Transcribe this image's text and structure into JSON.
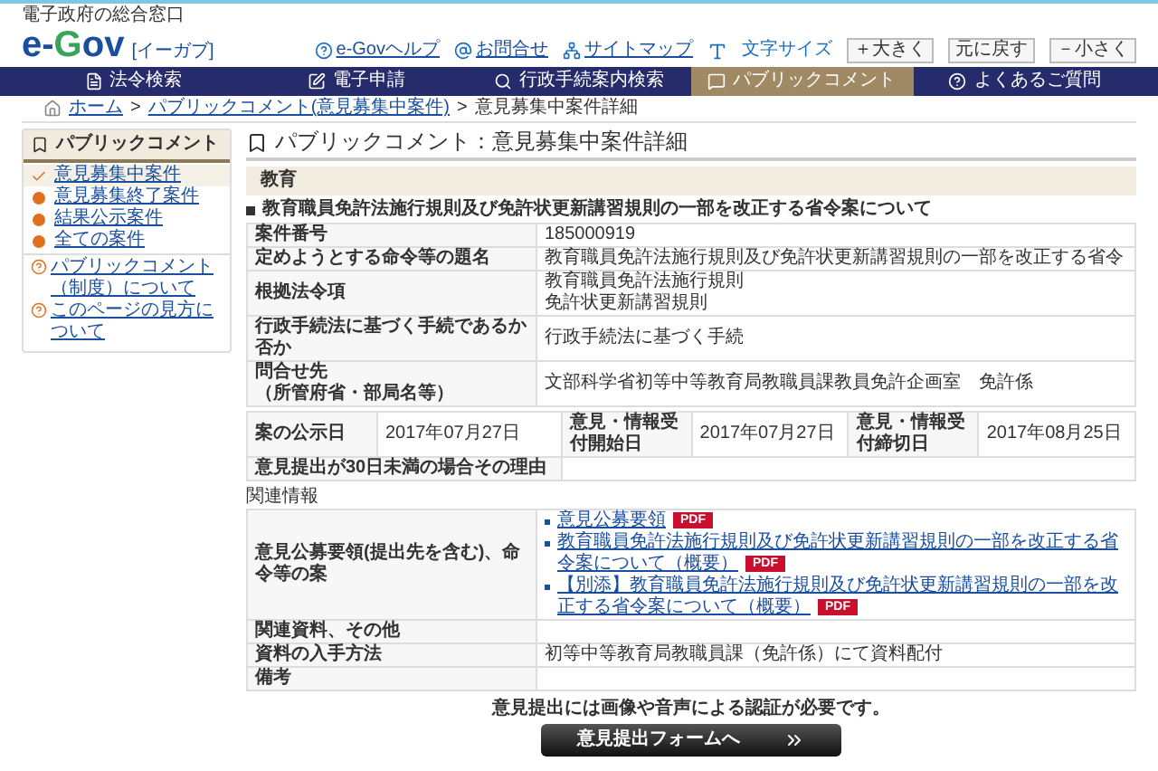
{
  "header": {
    "tagline": "電子政府の総合窓口",
    "logo": "e-Gov",
    "logo_sub": "[イーガブ]",
    "utility_links": [
      {
        "label": "e-Govヘルプ",
        "kind": "help"
      },
      {
        "label": "お問合せ",
        "kind": "mail"
      },
      {
        "label": "サイトマップ",
        "kind": "sitemap"
      }
    ],
    "font_size_label": "文字サイズ",
    "font_size_buttons": [
      "＋大きく",
      "元に戻す",
      "－小さく"
    ]
  },
  "nav": [
    {
      "label": "法令検索",
      "selected": false
    },
    {
      "label": "電子申請",
      "selected": false
    },
    {
      "label": "行政手続案内検索",
      "selected": false
    },
    {
      "label": "パブリックコメント",
      "selected": true
    },
    {
      "label": "よくあるご質問",
      "selected": false
    }
  ],
  "breadcrumb": [
    {
      "label": "ホーム",
      "link": true
    },
    {
      "separator": ">",
      "label": "パブリックコメント(意見募集中案件)",
      "link": true
    },
    {
      "separator": ">",
      "label": "意見募集中案件詳細",
      "link": false
    }
  ],
  "sidebar": {
    "title": "パブリックコメント",
    "items": [
      {
        "label": "意見募集中案件",
        "selected": true
      },
      {
        "label": "意見募集終了案件",
        "selected": false
      },
      {
        "label": "結果公示案件",
        "selected": false
      },
      {
        "label": "全ての案件",
        "selected": false
      }
    ],
    "help_links": [
      "パブリックコメント（制度）について",
      "このページの見方について"
    ]
  },
  "main": {
    "title": "パブリックコメント：意見募集中案件詳細",
    "category": "教育",
    "subject": "教育職員免許法施行規則及び免許状更新講習規則の一部を改正する省令案について",
    "detail_rows": [
      {
        "label": "案件番号",
        "values": [
          "185000919"
        ]
      },
      {
        "label": "定めようとする命令等の題名",
        "values": [
          "教育職員免許法施行規則及び免許状更新講習規則の一部を改正する省令"
        ]
      },
      {
        "label": "根拠法令項",
        "values": [
          "教育職員免許法施行規則",
          "免許状更新講習規則"
        ]
      },
      {
        "label": "行政手続法に基づく手続であるか否か",
        "values": [
          "行政手続法に基づく手続"
        ]
      },
      {
        "label": "問合せ先",
        "label_note": "（所管府省・部局名等）",
        "values": [
          "文部科学省初等中等教育局教職員課教員免許企画室　免許係"
        ]
      }
    ],
    "dates": [
      {
        "label": "案の公示日",
        "value": "2017年07月27日"
      },
      {
        "label": "意見・情報受付開始日",
        "value": "2017年07月27日"
      },
      {
        "label": "意見・情報受付締切日",
        "value": "2017年08月25日"
      }
    ],
    "reason_label": "意見提出が30日未満の場合その理由",
    "related_heading": "関連情報",
    "related_rows": [
      {
        "label": "意見公募要領(提出先を含む)、命令等の案",
        "kind": "links",
        "links": [
          {
            "label": "意見公募要領",
            "badge": "PDF"
          },
          {
            "label": "教育職員免許法施行規則及び免許状更新講習規則の一部を改正する省令案について（概要）",
            "badge": "PDF"
          },
          {
            "label": "【別添】教育職員免許法施行規則及び免許状更新講習規則の一部を改正する省令案について（概要）",
            "badge": "PDF"
          }
        ]
      },
      {
        "label": "関連資料、その他",
        "kind": "text"
      },
      {
        "label": "資料の入手方法",
        "kind": "text",
        "value": "初等中等教育局教職員課（免許係）にて資料配付"
      },
      {
        "label": "備考",
        "kind": "text"
      }
    ],
    "notice": "意見提出には画像や音声による認証が必要です。",
    "submit_button": "意見提出フォームへ"
  }
}
